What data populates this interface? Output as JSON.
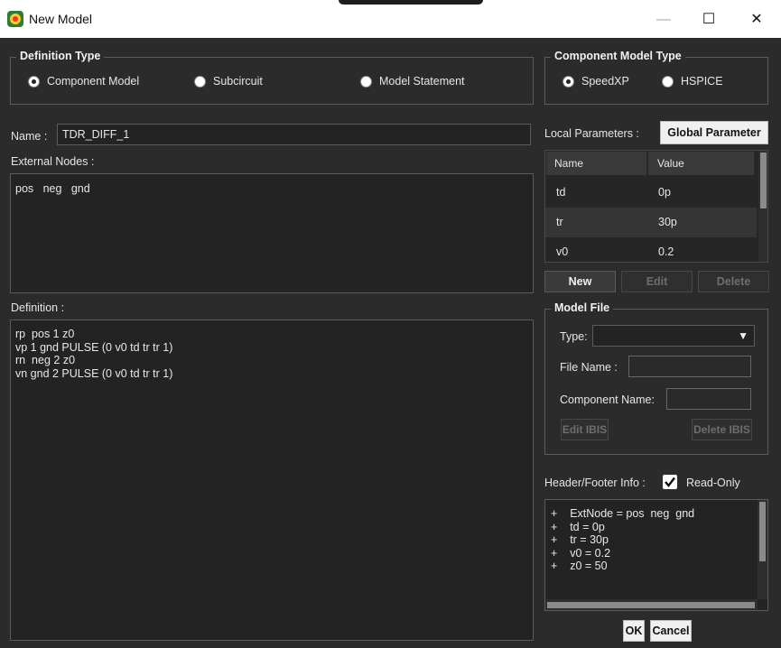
{
  "window": {
    "title": "New Model",
    "minimize": "—",
    "maximize": "☐",
    "close": "✕"
  },
  "definition_type": {
    "label": "Definition Type",
    "options": [
      "Component Model",
      "Subcircuit",
      "Model Statement"
    ],
    "selected": "Component Model"
  },
  "component_model_type": {
    "label": "Component Model Type",
    "options": [
      "SpeedXP",
      "HSPICE"
    ],
    "selected": "SpeedXP"
  },
  "name": {
    "label": "Name :",
    "value": "TDR_DIFF_1"
  },
  "external_nodes": {
    "label": "External Nodes :",
    "value": "pos   neg   gnd"
  },
  "definition": {
    "label": "Definition :",
    "value": "rp  pos 1 z0\nvp 1 gnd PULSE (0 v0 td tr tr 1)\nrn  neg 2 z0\nvn gnd 2 PULSE (0 v0 td tr tr 1)"
  },
  "local_parameters": {
    "label": "Local Parameters :",
    "global_button": "Global Parameter",
    "columns": [
      "Name",
      "Value"
    ],
    "rows": [
      {
        "name": "td",
        "value": "0p"
      },
      {
        "name": "tr",
        "value": "30p"
      },
      {
        "name": "v0",
        "value": "0.2"
      }
    ],
    "selected_row": 1,
    "buttons": {
      "new": "New",
      "edit": "Edit",
      "delete": "Delete"
    }
  },
  "model_file": {
    "label": "Model File",
    "type_label": "Type:",
    "type_value": "",
    "file_name_label": "File Name :",
    "file_name_value": "",
    "component_name_label": "Component Name:",
    "component_name_value": "",
    "edit_ibis": "Edit IBIS",
    "delete_ibis": "Delete IBIS"
  },
  "header_footer": {
    "label": "Header/Footer Info :",
    "readonly_label": "Read-Only",
    "readonly_checked": true,
    "value": "+    ExtNode = pos  neg  gnd\n+    td = 0p\n+    tr = 30p\n+    v0 = 0.2\n+    z0 = 50"
  },
  "footer": {
    "ok": "OK",
    "cancel": "Cancel"
  },
  "colors": {
    "background": "#2b2b2b",
    "titlebar": "#ffffff",
    "selected_row": "#353535"
  }
}
